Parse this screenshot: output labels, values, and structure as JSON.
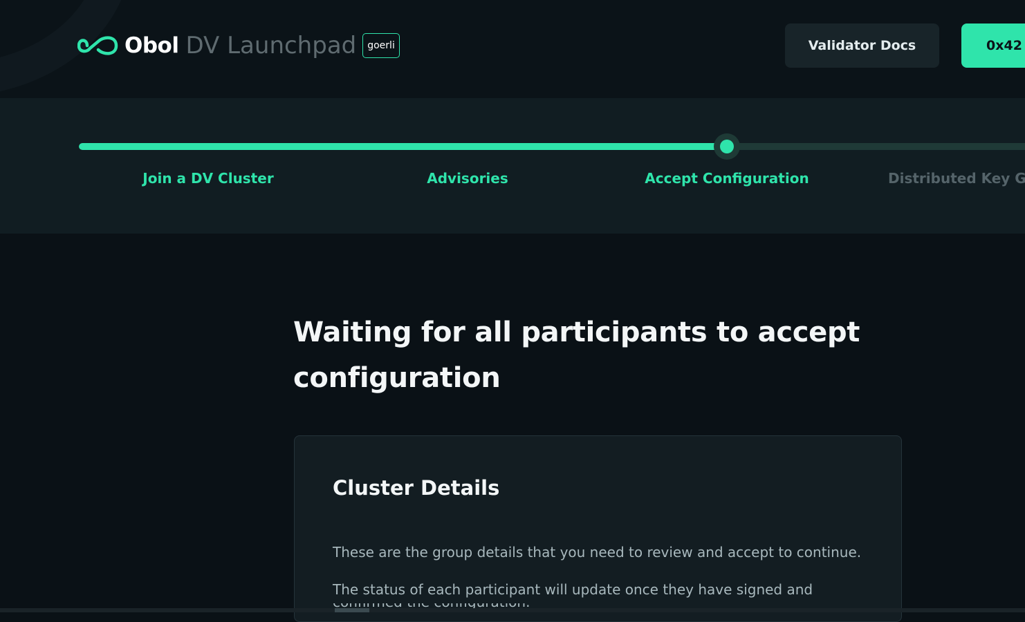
{
  "header": {
    "brand": "Obol",
    "app_name": "DV Launchpad",
    "network_badge": "goerli",
    "docs_button": "Validator Docs",
    "wallet_button": "0x42",
    "logo_icon": "infinity-icon",
    "accent_color": "#2fe4ab"
  },
  "stepper": {
    "progress": 0.685,
    "current_step": 3,
    "steps": [
      {
        "label": "Join a DV Cluster",
        "state": "done"
      },
      {
        "label": "Advisories",
        "state": "done"
      },
      {
        "label": "Accept Configuration",
        "state": "current"
      },
      {
        "label": "Distributed Key Ge",
        "state": "todo"
      }
    ]
  },
  "main": {
    "title": "Waiting for all participants to accept configuration",
    "card": {
      "title": "Cluster Details",
      "paragraph1": "These are the group details that you need to review and accept to continue.",
      "paragraph2": "The status of each participant will update once they have signed and",
      "paragraph3": "confirmed the configuration."
    }
  }
}
